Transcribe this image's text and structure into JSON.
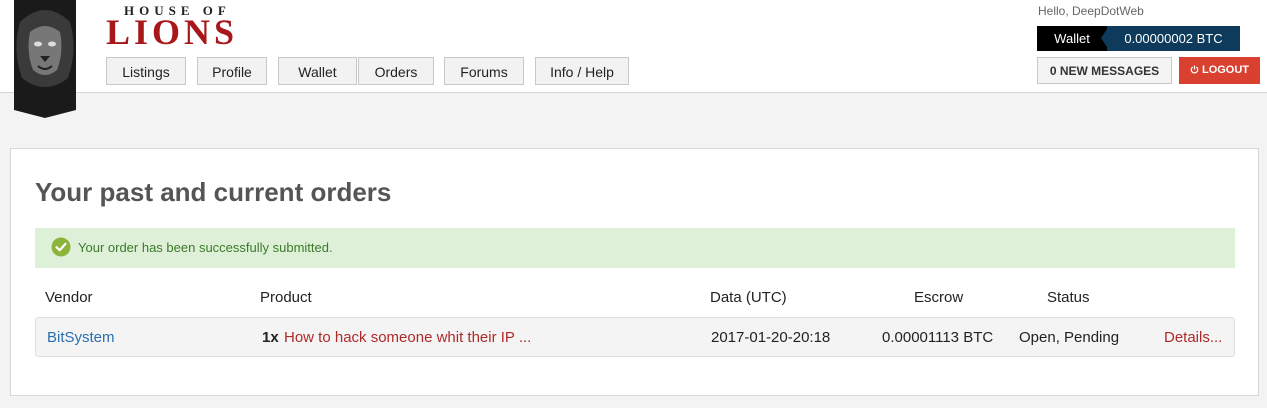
{
  "brand": {
    "top_text": "HOUSE OF",
    "main_text": "LIONS"
  },
  "nav": {
    "items": [
      {
        "label": "Listings"
      },
      {
        "label": "Profile"
      },
      {
        "label": "Wallet"
      },
      {
        "label": "Orders"
      },
      {
        "label": "Forums"
      },
      {
        "label": "Info / Help"
      }
    ]
  },
  "account": {
    "greeting": "Hello, DeepDotWeb",
    "wallet_label": "Wallet",
    "wallet_balance": "0.00000002 BTC",
    "messages_label": "0 NEW MESSAGES",
    "logout_label": "LOGOUT"
  },
  "colors": {
    "brand_red": "#a8171a",
    "wallet_blue": "#0e3a5c",
    "logout_red": "#d9402f",
    "success_bg": "#dff0d8",
    "success_icon": "#8cb33a"
  },
  "main": {
    "title": "Your past and current orders",
    "alert_text": "Your order has been successfully submitted.",
    "columns": {
      "vendor": "Vendor",
      "product": "Product",
      "date": "Data (UTC)",
      "escrow": "Escrow",
      "status": "Status"
    },
    "orders": [
      {
        "vendor": "BitSystem",
        "quantity": "1x",
        "product": "How to hack someone whit their IP ...",
        "date": "2017-01-20-20:18",
        "escrow": "0.00001113 BTC",
        "status": "Open, Pending",
        "details": "Details..."
      }
    ]
  }
}
